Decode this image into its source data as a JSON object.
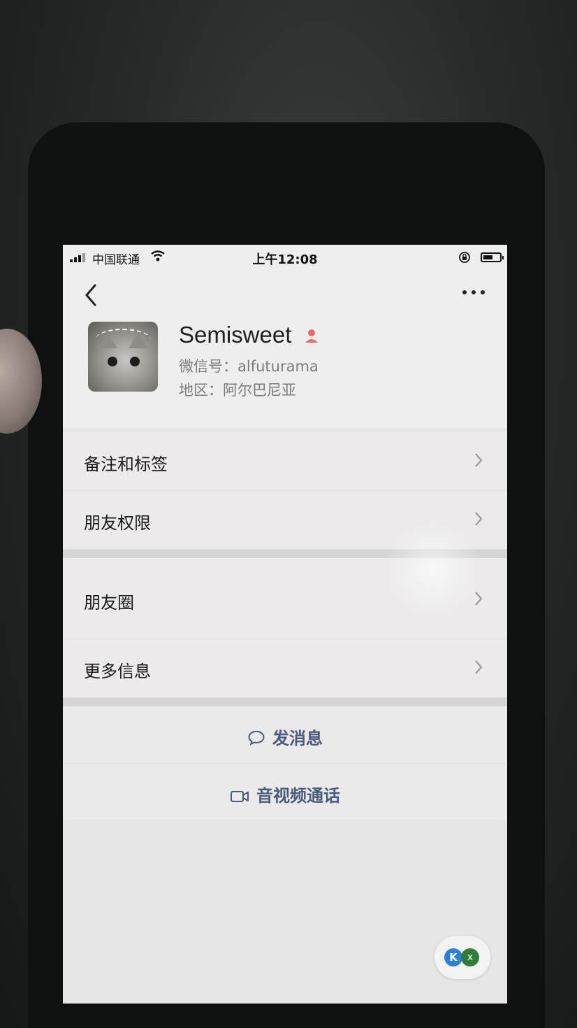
{
  "status_bar": {
    "carrier": "中国联通",
    "time": "上午12:08",
    "icons": [
      "signal-icon",
      "wifi-icon",
      "orientation-lock-icon",
      "battery-icon"
    ],
    "battery_level": 0.6
  },
  "nav": {
    "back_icon": "chevron-left-icon",
    "more_icon": "more-dots-icon"
  },
  "profile": {
    "name": "Semisweet",
    "gender_icon": "female-icon",
    "gender_color": "#e86b6b",
    "wechat_id": "微信号：alfuturama",
    "region": "地区：阿尔巴尼亚"
  },
  "menu": {
    "remarks_tags": "备注和标签",
    "friend_permissions": "朋友权限",
    "moments": "朋友圈",
    "more_info": "更多信息"
  },
  "actions": {
    "send_message": "发消息",
    "video_call": "音视频通话",
    "action_color": "#4b5b7b"
  },
  "floating_widget": {
    "left_glyph": "K",
    "right_glyph": "x"
  }
}
